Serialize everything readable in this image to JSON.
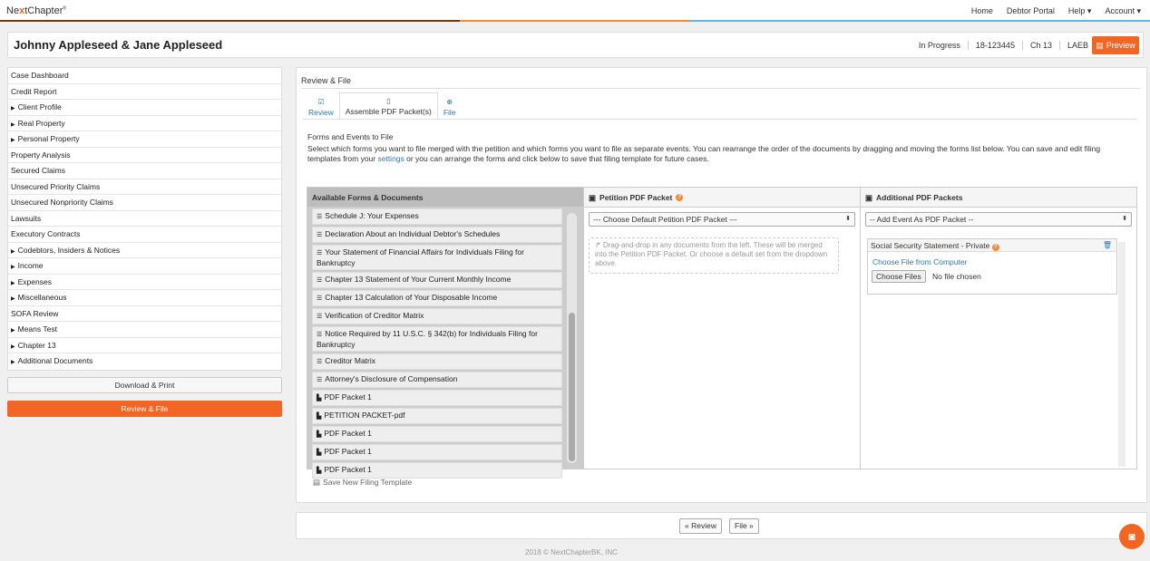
{
  "app": {
    "logo_pre": "Ne",
    "logo_x": "x",
    "logo_post": "tChapter",
    "logo_mark": "®"
  },
  "topnav": [
    "Home",
    "Debtor Portal",
    "Help ▾",
    "Account ▾"
  ],
  "case": {
    "title": "Johnny Appleseed & Jane Appleseed",
    "status": "In Progress",
    "number": "18-123445",
    "chapter": "Ch 13",
    "district": "LAEB",
    "preview_label": "Preview"
  },
  "sidebar": {
    "items": [
      {
        "label": "Case Dashboard",
        "caret": false
      },
      {
        "label": "Credit Report",
        "caret": false
      },
      {
        "label": "Client Profile",
        "caret": true
      },
      {
        "label": "Real Property",
        "caret": true
      },
      {
        "label": "Personal Property",
        "caret": true
      },
      {
        "label": "Property Analysis",
        "caret": false
      },
      {
        "label": "Secured Claims",
        "caret": false
      },
      {
        "label": "Unsecured Priority Claims",
        "caret": false
      },
      {
        "label": "Unsecured Nonpriority Claims",
        "caret": false
      },
      {
        "label": "Lawsuits",
        "caret": false
      },
      {
        "label": "Executory Contracts",
        "caret": false
      },
      {
        "label": "Codebtors, Insiders & Notices",
        "caret": true
      },
      {
        "label": "Income",
        "caret": true
      },
      {
        "label": "Expenses",
        "caret": true
      },
      {
        "label": "Miscellaneous",
        "caret": true
      },
      {
        "label": "SOFA Review",
        "caret": false
      },
      {
        "label": "Means Test",
        "caret": true
      },
      {
        "label": "Chapter 13",
        "caret": true
      },
      {
        "label": "Additional Documents",
        "caret": true
      }
    ],
    "download_label": "Download & Print",
    "review_label": "Review & File"
  },
  "main": {
    "section_title": "Review & File",
    "tabs": [
      {
        "label": "Review",
        "icon": "check-square-icon"
      },
      {
        "label": "Assemble PDF Packet(s)",
        "icon": "file-icon"
      },
      {
        "label": "File",
        "icon": "upload-icon"
      }
    ],
    "forms_heading": "Forms and Events to File",
    "forms_desc_1": "Select which forms you want to file merged with the petition and which forms you want to file as separate events. You can rearrange the order of the documents by dragging and moving the forms list below. You can save and edit filing templates from your ",
    "forms_desc_link": "settings",
    "forms_desc_2": " or you can arrange the forms and click below to save that filing template for future cases.",
    "available_header": "Available Forms & Documents",
    "documents": [
      {
        "label": "Schedule J: Your Expenses",
        "type": "form"
      },
      {
        "label": "Declaration About an Individual Debtor's Schedules",
        "type": "form"
      },
      {
        "label": "Your Statement of Financial Affairs for Individuals Filing for Bankruptcy",
        "type": "form"
      },
      {
        "label": "Chapter 13 Statement of Your Current Monthly Income",
        "type": "form"
      },
      {
        "label": "Chapter 13 Calculation of Your Disposable Income",
        "type": "form"
      },
      {
        "label": "Verification of Creditor Matrix",
        "type": "form"
      },
      {
        "label": "Notice Required by 11 U.S.C. § 342(b) for Individuals Filing for Bankruptcy",
        "type": "form"
      },
      {
        "label": "Creditor Matrix",
        "type": "form"
      },
      {
        "label": "Attorney's Disclosure of Compensation",
        "type": "form"
      },
      {
        "label": "PDF Packet 1",
        "type": "file"
      },
      {
        "label": "PETITION PACKET-pdf",
        "type": "file"
      },
      {
        "label": "PDF Packet 1",
        "type": "file"
      },
      {
        "label": "PDF Packet 1",
        "type": "file"
      },
      {
        "label": "PDF Packet 1",
        "type": "file"
      }
    ],
    "petition_header": "Petition PDF Packet",
    "petition_select": "--- Choose Default Petition PDF Packet ---",
    "petition_dropzone": "Drag-and-drop in any documents from the left. These will be merged into the Petition PDF Packet. Or choose a default set from the dropdown above.",
    "additional_header": "Additional PDF Packets",
    "additional_select": "-- Add Event As PDF Packet --",
    "packet_title": "Social Security Statement - Private",
    "choose_link": "Choose File from Computer",
    "file_button": "Choose Files",
    "file_status": "No file chosen",
    "save_template": "Save New Filing Template"
  },
  "footer": {
    "prev_label": "« Review",
    "next_label": "File »",
    "copyright": "2018 © NextChapterBK, INC"
  }
}
